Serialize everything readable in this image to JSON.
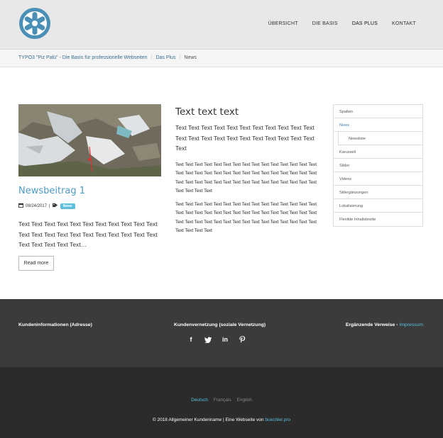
{
  "header": {
    "nav": [
      {
        "label": "ÜBERSICHT",
        "active": false
      },
      {
        "label": "DIE BASIS",
        "active": false
      },
      {
        "label": "DAS PLUS",
        "active": true
      },
      {
        "label": "KONTAKT",
        "active": false
      }
    ],
    "brand_color": "#4a8fb5"
  },
  "breadcrumb": {
    "items": [
      "TYPO3 \"Piz Palü\" - Die Basis für professionelle Webseiten",
      "Das Plus",
      "News"
    ]
  },
  "news": {
    "title": "Newsbeitrag 1",
    "date": "08/24/2017",
    "separator": "|",
    "tag": "News",
    "teaser": "Text Text Text Text Text Text Text Text Text Text Text Text Text Text Text Text Text Text Text Text Text Text Text Text Text Text Text…",
    "read_more": "Read more"
  },
  "content": {
    "heading": "Text text text",
    "lead": "Text Text Text Text Text Text Text Text Text Text Text Text Text Text Text Text Text Text Text Text Text Text Text",
    "para1": "Text Text Text Text Text Text Text Text Text Text Text Text Text Text Text Text Text Text Text Text Text Text Text Text Text Text Text Text Text Text Text Text Text Text Text Text Text Text Text Text Text Text Text Text Text Text Text Text Text",
    "para2": "Text Text Text Text Text Text Text Text Text Text Text Text Text Text Text Text Text Text Text Text Text Text Text Text Text Text Text Text Text Text Text Text Text Text Text Text Text Text Text Text Text Text Text Text Text Text Text Text Text"
  },
  "subnav": {
    "items": [
      {
        "label": "Spalten",
        "state": ""
      },
      {
        "label": "News",
        "state": "active"
      },
      {
        "label": "Newsliste",
        "state": "sub"
      },
      {
        "label": "Karussell",
        "state": ""
      },
      {
        "label": "Slider",
        "state": ""
      },
      {
        "label": "Videos",
        "state": ""
      },
      {
        "label": "Stilergänzungen",
        "state": ""
      },
      {
        "label": "Lokalisierung",
        "state": ""
      },
      {
        "label": "Flexible Inhaltsbreite",
        "state": ""
      }
    ]
  },
  "footer": {
    "col1": "Kundeninformationen (Adresse)",
    "col2": "Kundenvernetzung (soziale Vernetzung)",
    "col3_prefix": "Ergänzende Verweise - ",
    "col3_link": "Impressum",
    "social_icons": [
      "facebook-icon",
      "twitter-icon",
      "linkedin-icon",
      "pinterest-icon"
    ],
    "langs": [
      {
        "label": "Deutsch",
        "active": true
      },
      {
        "label": "Français",
        "active": false
      },
      {
        "label": "English",
        "active": false
      }
    ],
    "copyright_prefix": "© 2018 Allgemeiner Kundenname | Eine Webseite von ",
    "copyright_link": "buechler.pro",
    "accent": "#5bc0de"
  }
}
